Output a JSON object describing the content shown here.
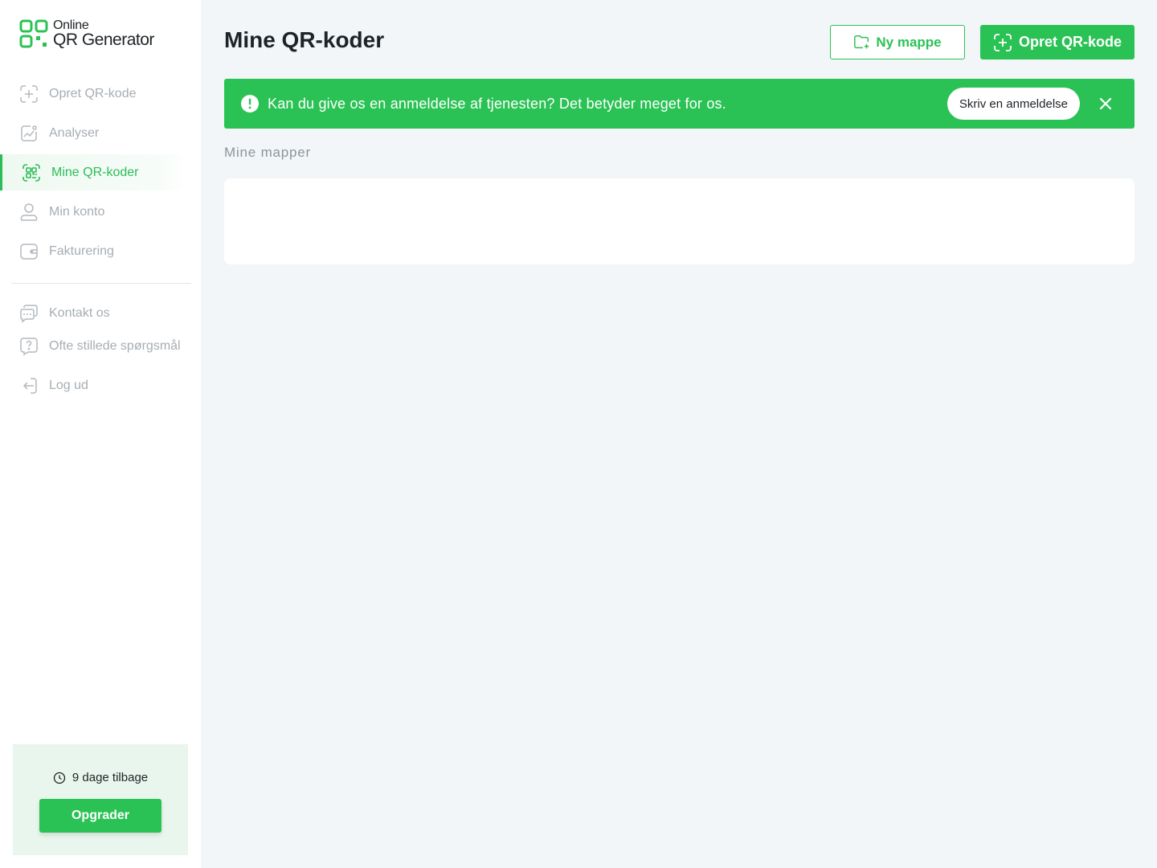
{
  "brand": {
    "line1": "Online",
    "line2": "QR Generator",
    "accent": "#2bc255"
  },
  "sidebar": {
    "items": [
      {
        "label": "Opret QR-kode",
        "icon": "plus-square-icon"
      },
      {
        "label": "Analyser",
        "icon": "chart-icon"
      },
      {
        "label": "Mine QR-koder",
        "icon": "qr-code-icon",
        "active": true
      },
      {
        "label": "Min konto",
        "icon": "user-icon"
      },
      {
        "label": "Fakturering",
        "icon": "wallet-icon"
      }
    ],
    "secondary": [
      {
        "label": "Kontakt os",
        "icon": "chat-icon"
      },
      {
        "label": "Ofte stillede spørgsmål",
        "icon": "help-icon"
      },
      {
        "label": "Log ud",
        "icon": "logout-icon"
      }
    ],
    "trial": {
      "text": "9 dage tilbage",
      "upgrade_label": "Opgrader"
    }
  },
  "header": {
    "title": "Mine QR-koder",
    "new_folder_label": "Ny mappe",
    "create_qr_label": "Opret QR-kode"
  },
  "banner": {
    "text": "Kan du give os en anmeldelse af tjenesten? Det betyder meget for os.",
    "review_label": "Skriv en anmeldelse"
  },
  "folders": {
    "section_label": "Mine mapper"
  }
}
